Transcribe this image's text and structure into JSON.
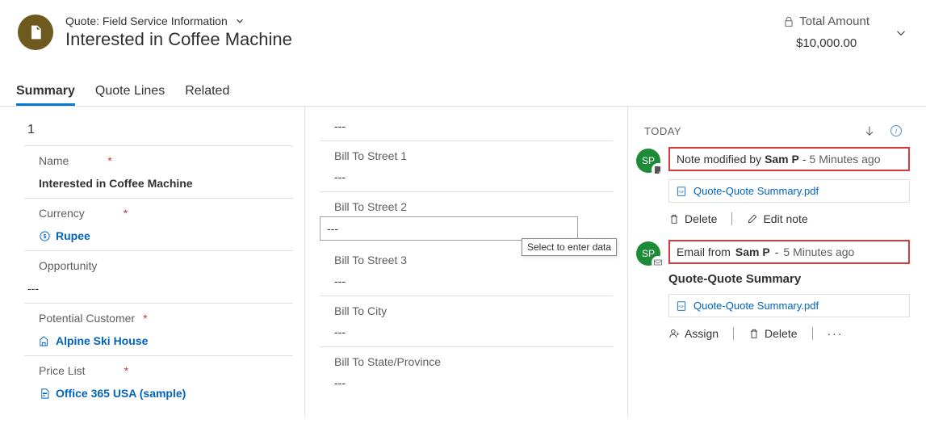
{
  "header": {
    "form_label": "Quote: Field Service Information",
    "title": "Interested in Coffee Machine",
    "total_label": "Total Amount",
    "total_value": "$10,000.00"
  },
  "tabs": [
    "Summary",
    "Quote Lines",
    "Related"
  ],
  "col1": {
    "top_value": "1",
    "fields": [
      {
        "label": "Name",
        "req": true,
        "value": "Interested in Coffee Machine",
        "bold": true
      },
      {
        "label": "Currency",
        "req": true,
        "value": "Rupee",
        "link": true,
        "icon": "currency"
      },
      {
        "label": "Opportunity",
        "req": false,
        "value": "---"
      },
      {
        "label": "Potential Customer",
        "req": true,
        "value": "Alpine Ski House",
        "link": true,
        "icon": "account"
      },
      {
        "label": "Price List",
        "req": true,
        "value": "Office 365 USA (sample)",
        "link": true,
        "icon": "pricelist"
      }
    ]
  },
  "col2": {
    "leading_value": "---",
    "fields": [
      {
        "label": "Bill To Street 1",
        "value": "---"
      },
      {
        "label": "Bill To Street 2",
        "value": "---",
        "editing": true
      },
      {
        "label": "Bill To Street 3",
        "value": "---"
      },
      {
        "label": "Bill To City",
        "value": "---"
      },
      {
        "label": "Bill To State/Province",
        "value": "---"
      }
    ],
    "tooltip": "Select to enter data"
  },
  "timeline": {
    "section": "TODAY",
    "items": [
      {
        "avatar": "SP",
        "type": "note",
        "head_prefix": "Note modified by",
        "user": "Sam P",
        "sep": "-",
        "ago": "5 Minutes ago",
        "attachment": "Quote-Quote Summary.pdf",
        "actions": {
          "delete": "Delete",
          "edit": "Edit note"
        }
      },
      {
        "avatar": "SP",
        "type": "email",
        "head_prefix": "Email from",
        "user": "Sam P",
        "sep": "-",
        "ago": "5 Minutes ago",
        "title": "Quote-Quote Summary",
        "attachment": "Quote-Quote Summary.pdf",
        "actions": {
          "assign": "Assign",
          "delete": "Delete"
        }
      }
    ]
  }
}
